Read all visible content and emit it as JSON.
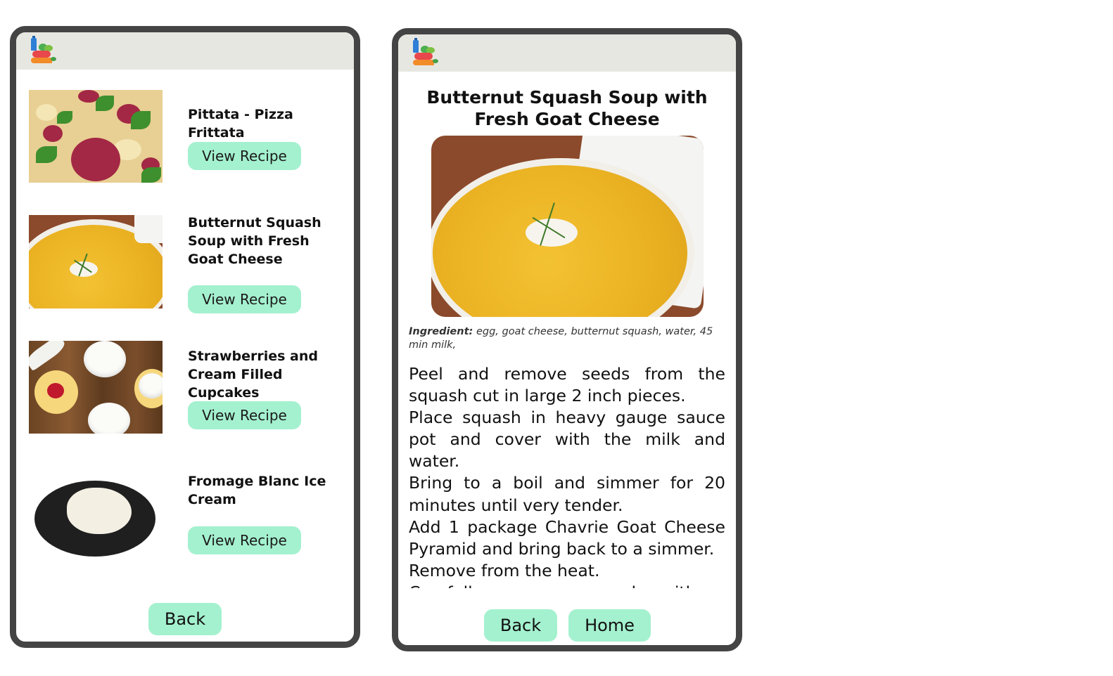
{
  "list_screen": {
    "items": [
      {
        "title": "Pittata - Pizza Frittata",
        "button": "View Recipe",
        "image": "pizza-frittata"
      },
      {
        "title": "Butternut Squash Soup with Fresh Goat Cheese",
        "button": "View Recipe",
        "image": "butternut-soup"
      },
      {
        "title": "Strawberries and Cream Filled Cupcakes",
        "button": "View Recipe",
        "image": "cupcakes"
      },
      {
        "title": "Fromage Blanc Ice Cream",
        "button": "View Recipe",
        "image": "ice-cream"
      }
    ],
    "back_label": "Back"
  },
  "detail_screen": {
    "title": "Butternut Squash Soup with Fresh Goat Cheese",
    "ingredient_label": "Ingredient:",
    "ingredients": "egg, goat cheese, butternut squash, water, 45 min milk,",
    "instructions": [
      "Peel and remove seeds from the squash cut in large 2 inch pieces.",
      "Place squash in heavy gauge sauce pot and cover with the milk and water.",
      "Bring to a boil and simmer for 20 minutes until very tender.",
      "Add 1 package Chavrie Goat Cheese Pyramid and bring back to a simmer.",
      "Remove from the heat.",
      "Carefully remove squash with a slotted spoon and place in blender."
    ],
    "back_label": "Back",
    "home_label": "Home"
  },
  "colors": {
    "button": "#a4f1cf",
    "topbar": "#e7e7e1",
    "frame": "#444444"
  },
  "icons": {
    "logo": "grocery-logo-icon"
  }
}
